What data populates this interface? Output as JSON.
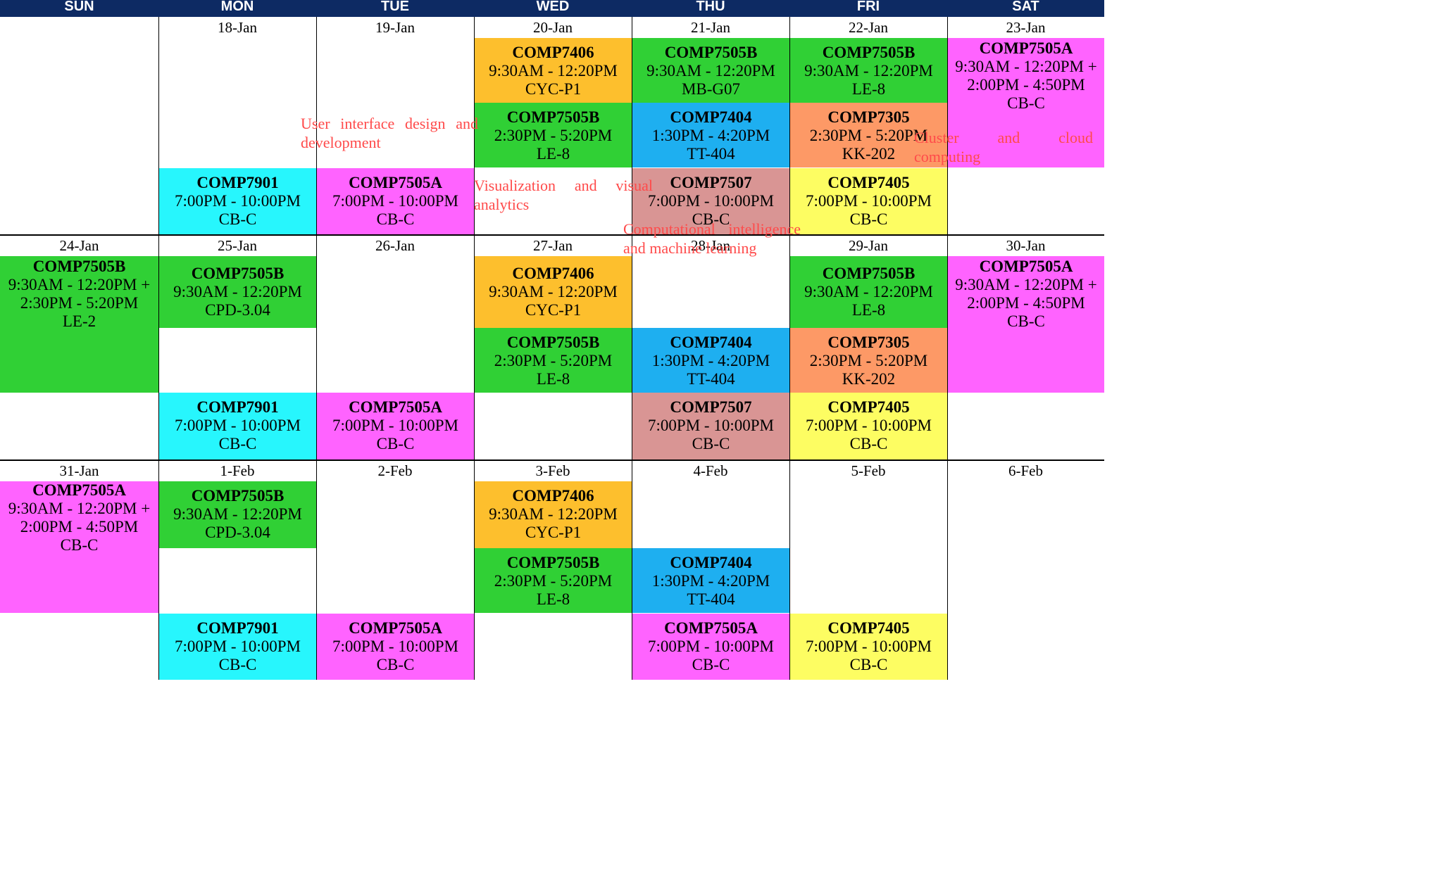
{
  "header": {
    "days": [
      "SUN",
      "MON",
      "TUE",
      "WED",
      "THU",
      "FRI",
      "SAT"
    ]
  },
  "weeks": [
    {
      "dates": [
        "",
        "18-Jan",
        "19-Jan",
        "20-Jan",
        "21-Jan",
        "22-Jan",
        "23-Jan"
      ]
    },
    {
      "dates": [
        "24-Jan",
        "25-Jan",
        "26-Jan",
        "27-Jan",
        "28-Jan",
        "29-Jan",
        "30-Jan"
      ]
    },
    {
      "dates": [
        "31-Jan",
        "1-Feb",
        "2-Feb",
        "3-Feb",
        "4-Feb",
        "5-Feb",
        "6-Feb"
      ]
    }
  ],
  "events": [
    {
      "code": "COMP7406",
      "time": "9:30AM - 12:20PM",
      "room": "CYC-P1",
      "color": "#fdbf2d"
    },
    {
      "code": "COMP7505B",
      "time": "9:30AM - 12:20PM",
      "room": "MB-G07",
      "color": "#30d035"
    },
    {
      "code": "COMP7505B",
      "time": "9:30AM - 12:20PM",
      "room": "LE-8",
      "color": "#30d035"
    },
    {
      "code": "COMP7505A",
      "time": "9:30AM - 12:20PM +",
      "time2": "2:00PM - 4:50PM",
      "room": "CB-C",
      "color": "#ff63ff"
    },
    {
      "code": "COMP7505B",
      "time": "2:30PM - 5:20PM",
      "room": "LE-8",
      "color": "#30d035"
    },
    {
      "code": "COMP7404",
      "time": "1:30PM - 4:20PM",
      "room": "TT-404",
      "color": "#1eaff0"
    },
    {
      "code": "COMP7305",
      "time": "2:30PM - 5:20PM",
      "room": "KK-202",
      "color": "#fd9966"
    },
    {
      "code": "COMP7901",
      "time": "7:00PM - 10:00PM",
      "room": "CB-C",
      "color": "#27f6fd"
    },
    {
      "code": "COMP7505A",
      "time": "7:00PM - 10:00PM",
      "room": "CB-C",
      "color": "#ff63ff"
    },
    {
      "code": "COMP7507",
      "time": "7:00PM - 10:00PM",
      "room": "CB-C",
      "color": "#d99594"
    },
    {
      "code": "COMP7405",
      "time": "7:00PM - 10:00PM",
      "room": "CB-C",
      "color": "#fdfd62"
    },
    {
      "code": "COMP7505B",
      "time": "9:30AM - 12:20PM +",
      "time2": "2:30PM - 5:20PM",
      "room": "LE-2",
      "color": "#30d035"
    },
    {
      "code": "COMP7505B",
      "time": "9:30AM - 12:20PM",
      "room": "CPD-3.04",
      "color": "#30d035"
    },
    {
      "code": "COMP7406",
      "time": "9:30AM - 12:20PM",
      "room": "CYC-P1",
      "color": "#fdbf2d"
    },
    {
      "code": "COMP7505B",
      "time": "9:30AM - 12:20PM",
      "room": "LE-8",
      "color": "#30d035"
    },
    {
      "code": "COMP7505A",
      "time": "9:30AM - 12:20PM +",
      "time2": "2:00PM - 4:50PM",
      "room": "CB-C",
      "color": "#ff63ff"
    },
    {
      "code": "COMP7505B",
      "time": "2:30PM - 5:20PM",
      "room": "LE-8",
      "color": "#30d035"
    },
    {
      "code": "COMP7404",
      "time": "1:30PM - 4:20PM",
      "room": "TT-404",
      "color": "#1eaff0"
    },
    {
      "code": "COMP7305",
      "time": "2:30PM - 5:20PM",
      "room": "KK-202",
      "color": "#fd9966"
    },
    {
      "code": "COMP7901",
      "time": "7:00PM - 10:00PM",
      "room": "CB-C",
      "color": "#27f6fd"
    },
    {
      "code": "COMP7505A",
      "time": "7:00PM - 10:00PM",
      "room": "CB-C",
      "color": "#ff63ff"
    },
    {
      "code": "COMP7507",
      "time": "7:00PM - 10:00PM",
      "room": "CB-C",
      "color": "#d99594"
    },
    {
      "code": "COMP7405",
      "time": "7:00PM - 10:00PM",
      "room": "CB-C",
      "color": "#fdfd62"
    },
    {
      "code": "COMP7505A",
      "time": "9:30AM - 12:20PM +",
      "time2": "2:00PM - 4:50PM",
      "room": "CB-C",
      "color": "#ff63ff"
    },
    {
      "code": "COMP7505B",
      "time": "9:30AM - 12:20PM",
      "room": "CPD-3.04",
      "color": "#30d035"
    },
    {
      "code": "COMP7406",
      "time": "9:30AM - 12:20PM",
      "room": "CYC-P1",
      "color": "#fdbf2d"
    },
    {
      "code": "COMP7505B",
      "time": "2:30PM - 5:20PM",
      "room": "LE-8",
      "color": "#30d035"
    },
    {
      "code": "COMP7404",
      "time": "1:30PM - 4:20PM",
      "room": "TT-404",
      "color": "#1eaff0"
    },
    {
      "code": "COMP7901",
      "time": "7:00PM - 10:00PM",
      "room": "CB-C",
      "color": "#27f6fd"
    },
    {
      "code": "COMP7505A",
      "time": "7:00PM - 10:00PM",
      "room": "CB-C",
      "color": "#ff63ff"
    },
    {
      "code": "COMP7505A",
      "time": "7:00PM - 10:00PM",
      "room": "CB-C",
      "color": "#ff63ff"
    },
    {
      "code": "COMP7405",
      "time": "7:00PM - 10:00PM",
      "room": "CB-C",
      "color": "#fdfd62"
    }
  ],
  "notes": [
    {
      "text": "User interface design and development"
    },
    {
      "text": "Visualization and visual analytics"
    },
    {
      "text": "Computational intelligence and machine learning"
    },
    {
      "text": "Cluster and cloud computing"
    }
  ]
}
